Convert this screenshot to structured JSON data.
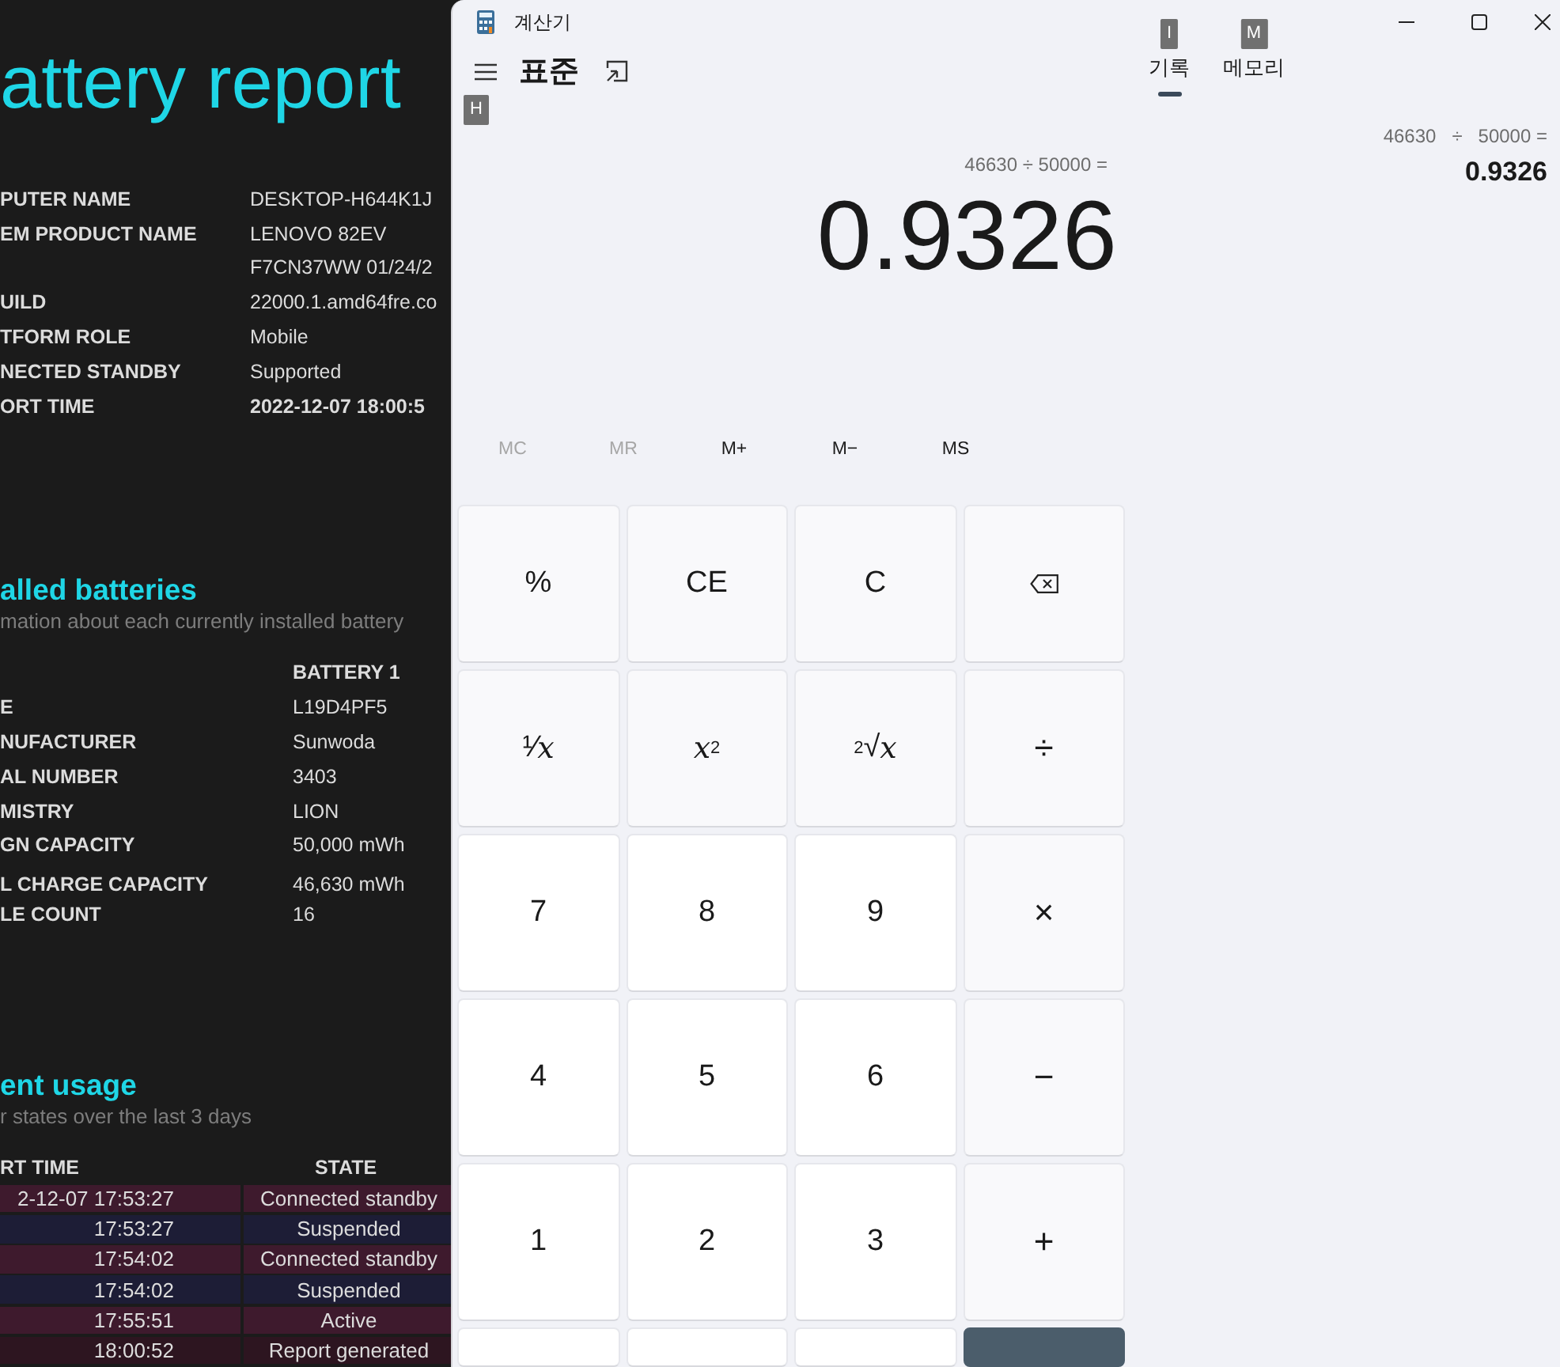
{
  "report": {
    "title": "attery report",
    "system_rows": [
      {
        "label": "PUTER NAME",
        "value": "DESKTOP-H644K1J",
        "bold": false
      },
      {
        "label": "EM PRODUCT NAME",
        "value": "LENOVO 82EV",
        "bold": false
      },
      {
        "value": "F7CN37WW 01/24/2",
        "bold": false
      },
      {
        "label": "UILD",
        "value": "22000.1.amd64fre.co",
        "bold": false
      },
      {
        "label": "TFORM ROLE",
        "value": "Mobile",
        "bold": false
      },
      {
        "label": "NECTED STANDBY",
        "value": "Supported",
        "bold": false
      },
      {
        "label": "ORT TIME",
        "value": "2022-12-07  18:00:5",
        "bold": true
      }
    ],
    "batteries": {
      "heading": "alled batteries",
      "subtitle": "mation about each currently installed battery",
      "column": "BATTERY 1",
      "rows": [
        {
          "label": "E",
          "value": "L19D4PF5"
        },
        {
          "label": "NUFACTURER",
          "value": "Sunwoda"
        },
        {
          "label": "AL NUMBER",
          "value": "3403"
        },
        {
          "label": "MISTRY",
          "value": "LION"
        },
        {
          "label": "GN CAPACITY",
          "value": "50,000 mWh"
        },
        {
          "label": "L CHARGE CAPACITY",
          "value": "46,630 mWh"
        },
        {
          "label": "LE COUNT",
          "value": "16"
        }
      ]
    },
    "usage": {
      "heading": "ent usage",
      "subtitle": "r states over the last 3 days",
      "columns": [
        "RT TIME",
        "STATE"
      ],
      "rows": [
        {
          "time": "2-12-07  17:53:27",
          "state": "Connected standby",
          "color": "#3e1a2d"
        },
        {
          "time": "17:53:27",
          "state": "Suspended",
          "color": "#1d1d36"
        },
        {
          "time": "17:54:02",
          "state": "Connected standby",
          "color": "#3e1a2d"
        },
        {
          "time": "17:54:02",
          "state": "Suspended",
          "color": "#1d1d36"
        },
        {
          "time": "17:55:51",
          "state": "Active",
          "color": "#3e1a2d"
        },
        {
          "time": "18:00:52",
          "state": "Report generated",
          "color": "#2d1520"
        }
      ]
    }
  },
  "calculator": {
    "title": "계산기",
    "mode": "표준",
    "menu_keytip": "H",
    "tabs": [
      {
        "label": "기록",
        "keytip": "I",
        "selected": true
      },
      {
        "label": "메모리",
        "keytip": "M",
        "selected": false
      }
    ],
    "expression": "46630 ÷ 50000 =",
    "result": "0.9326",
    "memory_buttons": [
      {
        "label": "MC",
        "disabled": true
      },
      {
        "label": "MR",
        "disabled": true
      },
      {
        "label": "M+",
        "disabled": false
      },
      {
        "label": "M−",
        "disabled": false
      },
      {
        "label": "MS",
        "disabled": false
      }
    ],
    "keys": [
      {
        "label": "%",
        "kind": "function"
      },
      {
        "label": "CE",
        "kind": "function"
      },
      {
        "label": "C",
        "kind": "function"
      },
      {
        "kind": "backspace"
      },
      {
        "label": "¹⁄*x*",
        "kind": "function"
      },
      {
        "label": "*x*$^{2}$",
        "kind": "function"
      },
      {
        "label": "$^{2}$√*x*",
        "kind": "function"
      },
      {
        "label": "÷",
        "kind": "operator"
      },
      {
        "label": "7",
        "kind": "digit"
      },
      {
        "label": "8",
        "kind": "digit"
      },
      {
        "label": "9",
        "kind": "digit"
      },
      {
        "label": "×",
        "kind": "operator"
      },
      {
        "label": "4",
        "kind": "digit"
      },
      {
        "label": "5",
        "kind": "digit"
      },
      {
        "label": "6",
        "kind": "digit"
      },
      {
        "label": "−",
        "kind": "operator"
      },
      {
        "label": "1",
        "kind": "digit"
      },
      {
        "label": "2",
        "kind": "digit"
      },
      {
        "label": "3",
        "kind": "digit"
      },
      {
        "label": "+",
        "kind": "operator"
      },
      {
        "kind": "digit"
      },
      {
        "kind": "digit"
      },
      {
        "kind": "digit"
      },
      {
        "kind": "equals"
      }
    ],
    "history": [
      {
        "expression": "46630   ÷   50000 =",
        "result": "0.9326"
      }
    ]
  }
}
